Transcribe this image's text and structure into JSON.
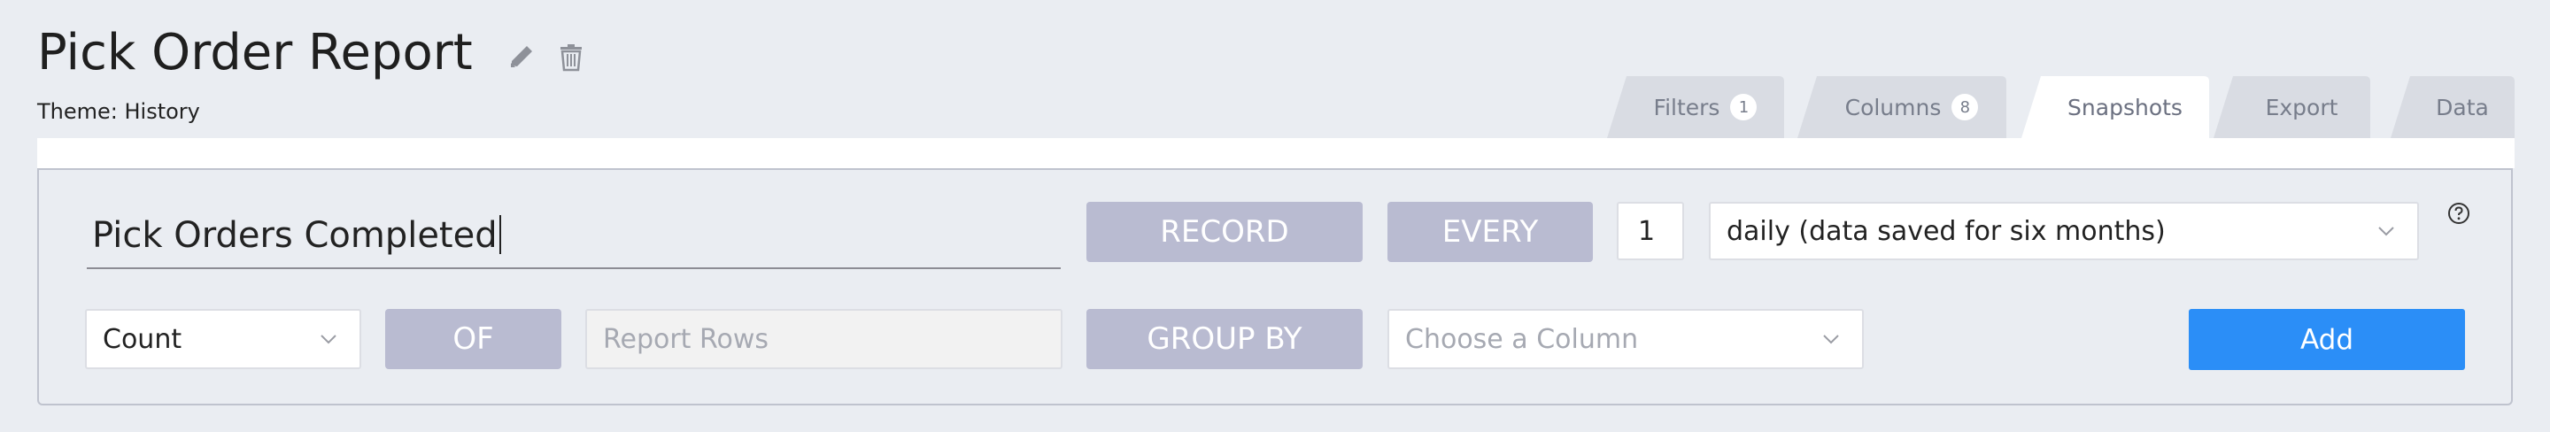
{
  "header": {
    "title": "Pick Order Report",
    "theme": "Theme: History"
  },
  "tabs": [
    {
      "label": "Filters",
      "badge": "1",
      "active": false
    },
    {
      "label": "Columns",
      "badge": "8",
      "active": false
    },
    {
      "label": "Snapshots",
      "badge": null,
      "active": true
    },
    {
      "label": "Export",
      "badge": null,
      "active": false
    },
    {
      "label": "Data",
      "badge": null,
      "active": false
    }
  ],
  "snapshot": {
    "name_value": "Pick Orders Completed",
    "record_label": "RECORD",
    "every_label": "EVERY",
    "interval_value": "1",
    "frequency_value": "daily (data saved for six months)",
    "aggregate_value": "Count",
    "of_label": "OF",
    "source_placeholder": "Report Rows",
    "group_by_label": "GROUP BY",
    "group_column_placeholder": "Choose a Column",
    "add_label": "Add"
  },
  "icons": {
    "edit": "pencil-icon",
    "delete": "trash-icon",
    "help": "question-circle-icon",
    "dropdown": "chevron-down-icon"
  },
  "colors": {
    "accent": "#2b8ef7",
    "label_button": "#b9bbd1",
    "background": "#eaedf2"
  }
}
